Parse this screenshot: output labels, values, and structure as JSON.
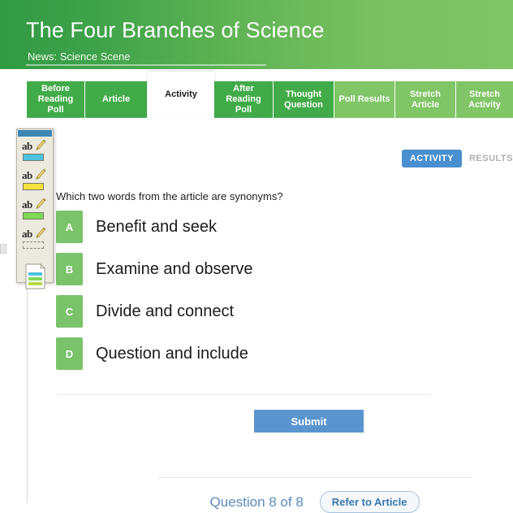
{
  "header": {
    "title": "The Four Branches of Science",
    "subtitle": "News: Science Scene",
    "gradient_from": "#319a43",
    "gradient_to": "#80c566"
  },
  "tabs": [
    {
      "label": "Before Reading Poll",
      "state": "normal"
    },
    {
      "label": "Article",
      "state": "normal"
    },
    {
      "label": "Activity",
      "state": "active"
    },
    {
      "label": "After Reading Poll",
      "state": "normal"
    },
    {
      "label": "Thought Question",
      "state": "normal"
    },
    {
      "label": "Poll Results",
      "state": "light"
    },
    {
      "label": "Stretch Article",
      "state": "light"
    },
    {
      "label": "Stretch Activity",
      "state": "light"
    }
  ],
  "view_toggle": {
    "active_label": "ACTIVITY",
    "inactive_label": "RESULTS",
    "active_color": "#4a8fcf"
  },
  "activity": {
    "question": "Which two words from the article are synonyms?",
    "options": [
      {
        "letter": "A",
        "text": "Benefit and seek"
      },
      {
        "letter": "B",
        "text": "Examine and observe"
      },
      {
        "letter": "C",
        "text": "Divide and connect"
      },
      {
        "letter": "D",
        "text": "Question and include"
      }
    ],
    "option_color": "#7ac36a",
    "submit_label": "Submit",
    "submit_color": "#5a94ce"
  },
  "footer": {
    "question_counter": "Question 8 of 8",
    "refer_label": "Refer to Article"
  },
  "tool_palette": {
    "tools": [
      {
        "name": "highlighter-blue",
        "swatch": "#4bc3e0"
      },
      {
        "name": "highlighter-yellow",
        "swatch": "#f5e23c"
      },
      {
        "name": "highlighter-green",
        "swatch": "#7ed957"
      },
      {
        "name": "highlighter-none",
        "swatch": "none"
      }
    ],
    "notes_icon": "document-notes-icon"
  }
}
